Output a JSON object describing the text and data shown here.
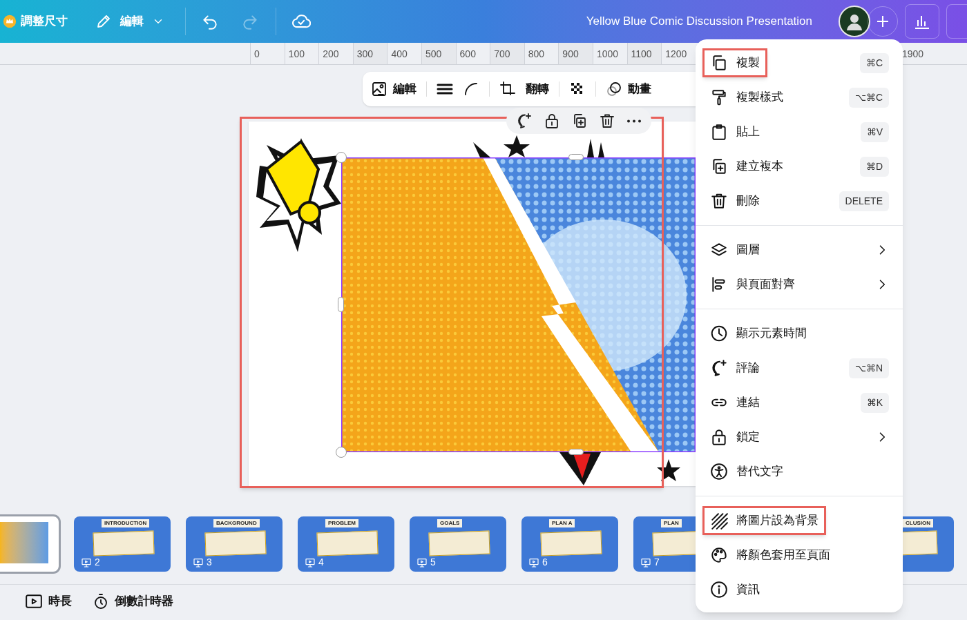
{
  "top_bar": {
    "resize_label": "調整尺寸",
    "edit_label": "編輯",
    "title": "Yellow Blue Comic Discussion Presentation"
  },
  "ruler": {
    "marks": [
      "0",
      "100",
      "200",
      "300",
      "400",
      "500",
      "600",
      "700",
      "800",
      "900",
      "1000",
      "1100",
      "1200"
    ],
    "far_mark": "1900"
  },
  "image_toolbar": [
    {
      "kind": "edit_image",
      "label": "編輯"
    },
    {
      "kind": "border"
    },
    {
      "kind": "corner"
    },
    {
      "kind": "crop"
    },
    {
      "kind": "flip",
      "label": "翻轉"
    },
    {
      "kind": "transparency"
    },
    {
      "kind": "animate",
      "label": "動畫"
    }
  ],
  "element_toolbar": [
    {
      "kind": "comment"
    },
    {
      "kind": "lock"
    },
    {
      "kind": "duplicate"
    },
    {
      "kind": "delete"
    },
    {
      "kind": "more"
    }
  ],
  "context_menu": [
    [
      {
        "kind": "copy",
        "label": "複製",
        "shortcut": "⌘C",
        "highlighted": true,
        "submenu": false
      },
      {
        "kind": "copy_style",
        "label": "複製樣式",
        "shortcut": "⌥⌘C",
        "highlighted": false,
        "submenu": false
      },
      {
        "kind": "paste",
        "label": "貼上",
        "shortcut": "⌘V",
        "highlighted": false,
        "submenu": false
      },
      {
        "kind": "duplicate",
        "label": "建立複本",
        "shortcut": "⌘D",
        "highlighted": false,
        "submenu": false
      },
      {
        "kind": "delete",
        "label": "刪除",
        "shortcut": "DELETE",
        "highlighted": false,
        "submenu": false
      }
    ],
    [
      {
        "kind": "layers",
        "label": "圖層",
        "highlighted": false,
        "submenu": true
      },
      {
        "kind": "align",
        "label": "與頁面對齊",
        "highlighted": false,
        "submenu": true
      }
    ],
    [
      {
        "kind": "timing",
        "label": "顯示元素時間",
        "highlighted": false,
        "submenu": false
      },
      {
        "kind": "comment",
        "label": "評論",
        "shortcut": "⌥⌘N",
        "highlighted": false,
        "submenu": false
      },
      {
        "kind": "link",
        "label": "連結",
        "shortcut": "⌘K",
        "highlighted": false,
        "submenu": false
      },
      {
        "kind": "lock",
        "label": "鎖定",
        "highlighted": false,
        "submenu": true
      },
      {
        "kind": "alt_text",
        "label": "替代文字",
        "highlighted": false,
        "submenu": false
      }
    ],
    [
      {
        "kind": "set_background",
        "label": "將圖片設為背景",
        "highlighted": true,
        "submenu": false
      },
      {
        "kind": "apply_colors",
        "label": "將顏色套用至頁面",
        "highlighted": false,
        "submenu": false
      },
      {
        "kind": "info",
        "label": "資訊",
        "highlighted": false,
        "submenu": false
      }
    ]
  ],
  "pages": [
    {
      "selected": true
    },
    {
      "title": "INTRODUCTION",
      "number": "2",
      "selected": false
    },
    {
      "title": "BACKGROUND",
      "number": "3",
      "selected": false
    },
    {
      "title": "PROBLEM",
      "number": "4",
      "selected": false
    },
    {
      "title": "GOALS",
      "number": "5",
      "selected": false
    },
    {
      "title": "PLAN A",
      "number": "6",
      "selected": false
    },
    {
      "title": "PLAN",
      "number": "7",
      "selected": false
    },
    {
      "title": "CLUSION",
      "selected": false
    }
  ],
  "bottom_bar": [
    {
      "kind": "duration",
      "label": "時長"
    },
    {
      "kind": "timer",
      "label": "倒數計時器"
    }
  ]
}
